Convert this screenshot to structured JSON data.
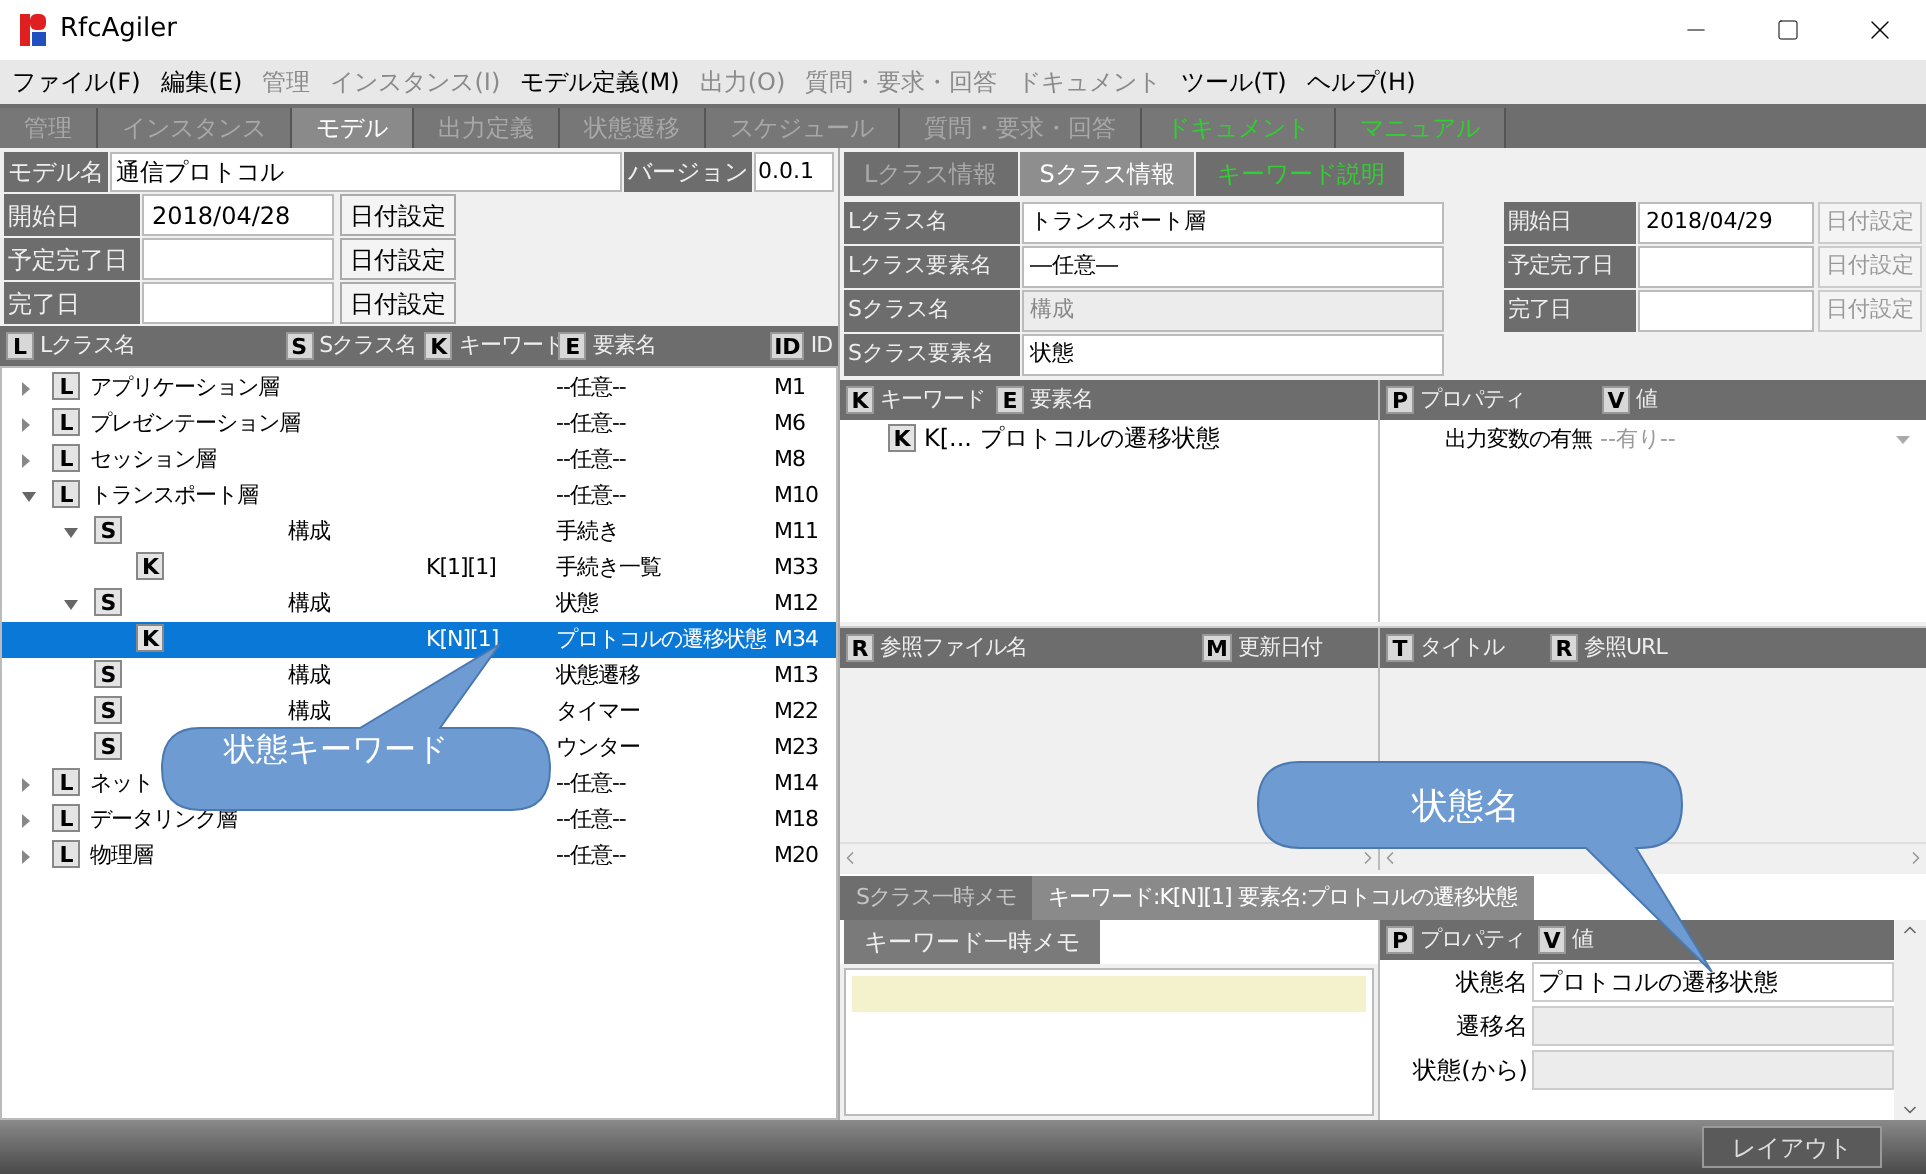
{
  "window": {
    "title": "RfcAgiler"
  },
  "menu": [
    {
      "label": "ファイル(F)",
      "disabled": false
    },
    {
      "label": "編集(E)",
      "disabled": false
    },
    {
      "label": "管理",
      "disabled": true
    },
    {
      "label": "インスタンス(I)",
      "disabled": true
    },
    {
      "label": "モデル定義(M)",
      "disabled": false
    },
    {
      "label": "出力(O)",
      "disabled": true
    },
    {
      "label": "質問・要求・回答",
      "disabled": true
    },
    {
      "label": "ドキュメント",
      "disabled": true
    },
    {
      "label": "ツール(T)",
      "disabled": false
    },
    {
      "label": "ヘルプ(H)",
      "disabled": false
    }
  ],
  "main_tabs": [
    {
      "label": "管理",
      "selected": false,
      "highlighted": false
    },
    {
      "label": "インスタンス",
      "selected": false,
      "highlighted": false
    },
    {
      "label": "モデル",
      "selected": true,
      "highlighted": false
    },
    {
      "label": "出力定義",
      "selected": false,
      "highlighted": false
    },
    {
      "label": "状態遷移",
      "selected": false,
      "highlighted": false
    },
    {
      "label": "スケジュール",
      "selected": false,
      "highlighted": false
    },
    {
      "label": "質問・要求・回答",
      "selected": false,
      "highlighted": false
    },
    {
      "label": "ドキュメント",
      "selected": false,
      "highlighted": true
    },
    {
      "label": "マニュアル",
      "selected": false,
      "highlighted": true
    }
  ],
  "model": {
    "name_label": "モデル名",
    "name": "通信プロトコル",
    "version_label": "バージョン",
    "version": "0.0.1",
    "dates": [
      {
        "label": "開始日",
        "value": "2018/04/28",
        "button": "日付設定"
      },
      {
        "label": "予定完了日",
        "button": "日付設定"
      },
      {
        "label": "完了日",
        "button": "日付設定"
      }
    ]
  },
  "tree": {
    "columns": [
      {
        "badge": "L",
        "label": "Lクラス名"
      },
      {
        "badge": "S",
        "label": "Sクラス名"
      },
      {
        "badge": "K",
        "label": "キーワード"
      },
      {
        "badge": "E",
        "label": "要素名"
      },
      {
        "badge": "ID",
        "label": "ID"
      }
    ],
    "rows": [
      {
        "badge": "L",
        "name": "アプリケーション層",
        "element": "--任意--",
        "id": "M1",
        "expanded": false,
        "selected": false
      },
      {
        "badge": "L",
        "name": "プレゼンテーション層",
        "element": "--任意--",
        "id": "M6",
        "expanded": false,
        "selected": false
      },
      {
        "badge": "L",
        "name": "セッション層",
        "element": "--任意--",
        "id": "M8",
        "expanded": false,
        "selected": false
      },
      {
        "badge": "L",
        "name": "トランスポート層",
        "element": "--任意--",
        "id": "M10",
        "expanded": true,
        "selected": false,
        "children": [
          {
            "badge": "S",
            "sclass": "構成",
            "element": "手続き",
            "id": "M11",
            "expanded": true,
            "selected": false,
            "children": [
              {
                "badge": "K",
                "keyword": "K[1][1]",
                "element": "手続き一覧",
                "id": "M33",
                "selected": false
              }
            ]
          },
          {
            "badge": "S",
            "sclass": "構成",
            "element": "状態",
            "id": "M12",
            "expanded": true,
            "selected": false,
            "children": [
              {
                "badge": "K",
                "keyword": "K[N][1]",
                "element": "プロトコルの遷移状態",
                "id": "M34",
                "selected": true
              }
            ]
          },
          {
            "badge": "S",
            "sclass": "構成",
            "element": "状態遷移",
            "id": "M13",
            "selected": false
          },
          {
            "badge": "S",
            "sclass": "構成",
            "element": "タイマー",
            "id": "M22",
            "selected": false
          },
          {
            "badge": "S",
            "element": "ウンター",
            "id": "M23",
            "selected": false
          }
        ]
      },
      {
        "badge": "L",
        "name": "ネット",
        "element": "--任意--",
        "id": "M14",
        "expanded": false,
        "selected": false
      },
      {
        "badge": "L",
        "name": "データリンク層",
        "element": "--任意--",
        "id": "M18",
        "expanded": false,
        "selected": false
      },
      {
        "badge": "L",
        "name": "物理層",
        "element": "--任意--",
        "id": "M20",
        "expanded": false,
        "selected": false
      }
    ]
  },
  "detail": {
    "tabs": [
      {
        "label": "Lクラス情報",
        "selected": false,
        "highlighted": false
      },
      {
        "label": "Sクラス情報",
        "selected": true,
        "highlighted": false
      },
      {
        "label": "キーワード説明",
        "selected": false,
        "highlighted": true
      }
    ],
    "fields": [
      {
        "label": "Lクラス名",
        "value": "トランスポート層",
        "disabled": false
      },
      {
        "label": "Lクラス要素名",
        "value": "―任意―",
        "disabled": false
      },
      {
        "label": "Sクラス名",
        "value": "構成",
        "disabled": true
      },
      {
        "label": "Sクラス要素名",
        "value": "状態",
        "disabled": false
      }
    ],
    "dates": [
      {
        "label": "開始日",
        "value": "2018/04/29",
        "button": "日付設定",
        "disabled": true
      },
      {
        "label": "予定完了日",
        "button": "日付設定",
        "disabled": true
      },
      {
        "label": "完了日",
        "button": "日付設定",
        "disabled": true
      }
    ],
    "keyword_table": {
      "columns": [
        {
          "badge": "K",
          "label": "キーワード"
        },
        {
          "badge": "E",
          "label": "要素名"
        }
      ],
      "rows": [
        {
          "badge": "K",
          "keyword": "K[...",
          "element": "プロトコルの遷移状態"
        }
      ]
    },
    "property_table": {
      "columns": [
        {
          "badge": "P",
          "label": "プロパティ"
        },
        {
          "badge": "V",
          "label": "値"
        }
      ],
      "rows": [
        {
          "name": "出力変数の有無",
          "value": "--有り--",
          "disabled": true
        }
      ]
    },
    "reference_table": {
      "columns": [
        {
          "badge": "R",
          "label": "参照ファイル名"
        },
        {
          "badge": "M",
          "label": "更新日付"
        }
      ]
    },
    "link_table": {
      "columns": [
        {
          "badge": "T",
          "label": "タイトル"
        },
        {
          "badge": "R",
          "label": "参照URL"
        }
      ]
    },
    "memo": {
      "tabs": [
        {
          "label": "Sクラス一時メモ",
          "selected": false
        },
        {
          "label": "キーワード:K[N][1] 要素名:プロトコルの遷移状態",
          "selected": true
        }
      ],
      "subtab": "キーワード一時メモ"
    },
    "state_properties": {
      "columns": [
        {
          "badge": "P",
          "label": "プロパティ"
        },
        {
          "badge": "V",
          "label": "値"
        }
      ],
      "rows": [
        {
          "name": "状態名",
          "value": "プロトコルの遷移状態",
          "disabled": false
        },
        {
          "name": "遷移名",
          "disabled": true
        },
        {
          "name": "状態(から)",
          "disabled": true
        }
      ]
    }
  },
  "callouts": [
    {
      "text": "状態キーワード"
    },
    {
      "text": "状態名"
    }
  ],
  "status_bar": {
    "button": "レイアウト"
  }
}
